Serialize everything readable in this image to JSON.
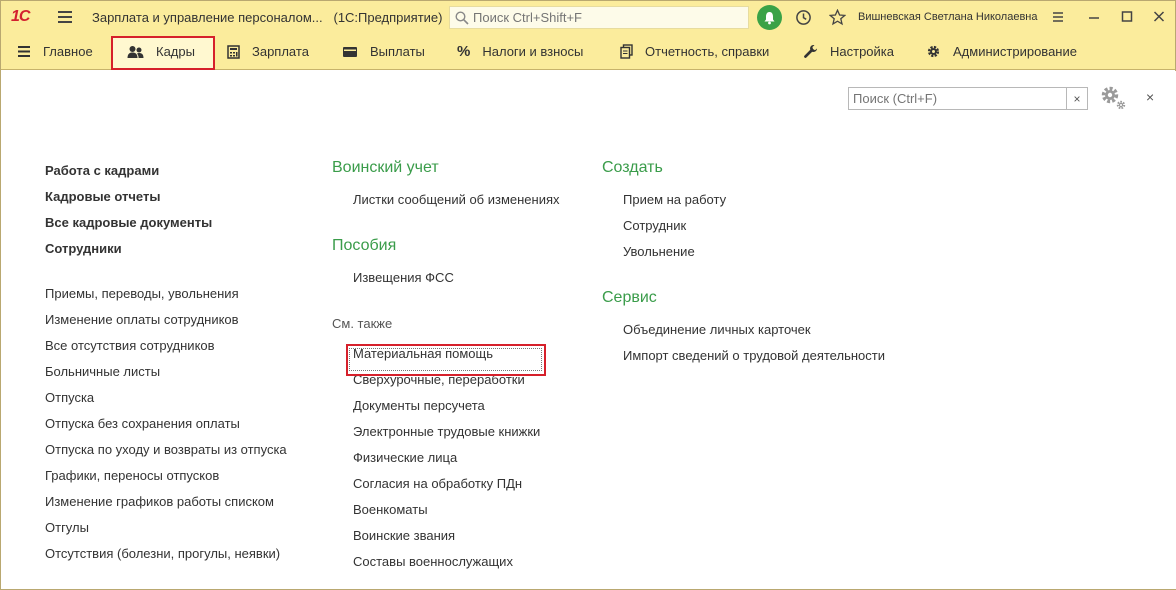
{
  "window": {
    "logo": "1С",
    "title": "Зарплата и управление персоналом...",
    "mode": "(1С:Предприятие)",
    "search_placeholder": "Поиск Ctrl+Shift+F",
    "user": "Вишневская Светлана Николаевна"
  },
  "sections": [
    {
      "label": "Главное",
      "icon": "menu-icon"
    },
    {
      "label": "Кадры",
      "icon": "people-icon",
      "active": true
    },
    {
      "label": "Зарплата",
      "icon": "calculator-icon"
    },
    {
      "label": "Выплаты",
      "icon": "wallet-icon"
    },
    {
      "label": "Налоги и взносы",
      "icon": "percent-icon"
    },
    {
      "label": "Отчетность, справки",
      "icon": "reports-icon"
    },
    {
      "label": "Настройка",
      "icon": "wrench-icon"
    },
    {
      "label": "Администрирование",
      "icon": "gear-icon"
    }
  ],
  "content": {
    "search_placeholder": "Поиск (Ctrl+F)",
    "search_clear": "×",
    "close": "×",
    "col1": {
      "main_links": [
        "Работа с кадрами",
        "Кадровые отчеты",
        "Все кадровые документы",
        "Сотрудники"
      ],
      "links": [
        "Приемы, переводы, увольнения",
        "Изменение оплаты сотрудников",
        "Все отсутствия сотрудников",
        "Больничные листы",
        "Отпуска",
        "Отпуска без сохранения оплаты",
        "Отпуска по уходу и возвраты из отпуска",
        "Графики, переносы отпусков",
        "Изменение графиков работы списком",
        "Отгулы",
        "Отсутствия (болезни, прогулы, неявки)"
      ]
    },
    "col2": {
      "group1": {
        "title": "Воинский учет",
        "items": [
          "Листки сообщений об изменениях"
        ]
      },
      "group2": {
        "title": "Пособия",
        "items": [
          "Извещения ФСС"
        ]
      },
      "see_also": "См. также",
      "see_also_items": [
        "Материальная помощь",
        "Сверхурочные, переработки",
        "Документы персучета",
        "Электронные трудовые книжки",
        "Физические лица",
        "Согласия на обработку ПДн",
        "Военкоматы",
        "Воинские звания",
        "Составы военнослужащих"
      ]
    },
    "col3": {
      "group1": {
        "title": "Создать",
        "items": [
          "Прием на работу",
          "Сотрудник",
          "Увольнение"
        ]
      },
      "group2": {
        "title": "Сервис",
        "items": [
          "Объединение личных карточек",
          "Импорт сведений о трудовой деятельности"
        ]
      }
    }
  },
  "colors": {
    "toolbar_bg": "#fbec9c",
    "group_title": "#3a9c4a",
    "highlight": "#d6202b",
    "bell": "#3aa247"
  }
}
